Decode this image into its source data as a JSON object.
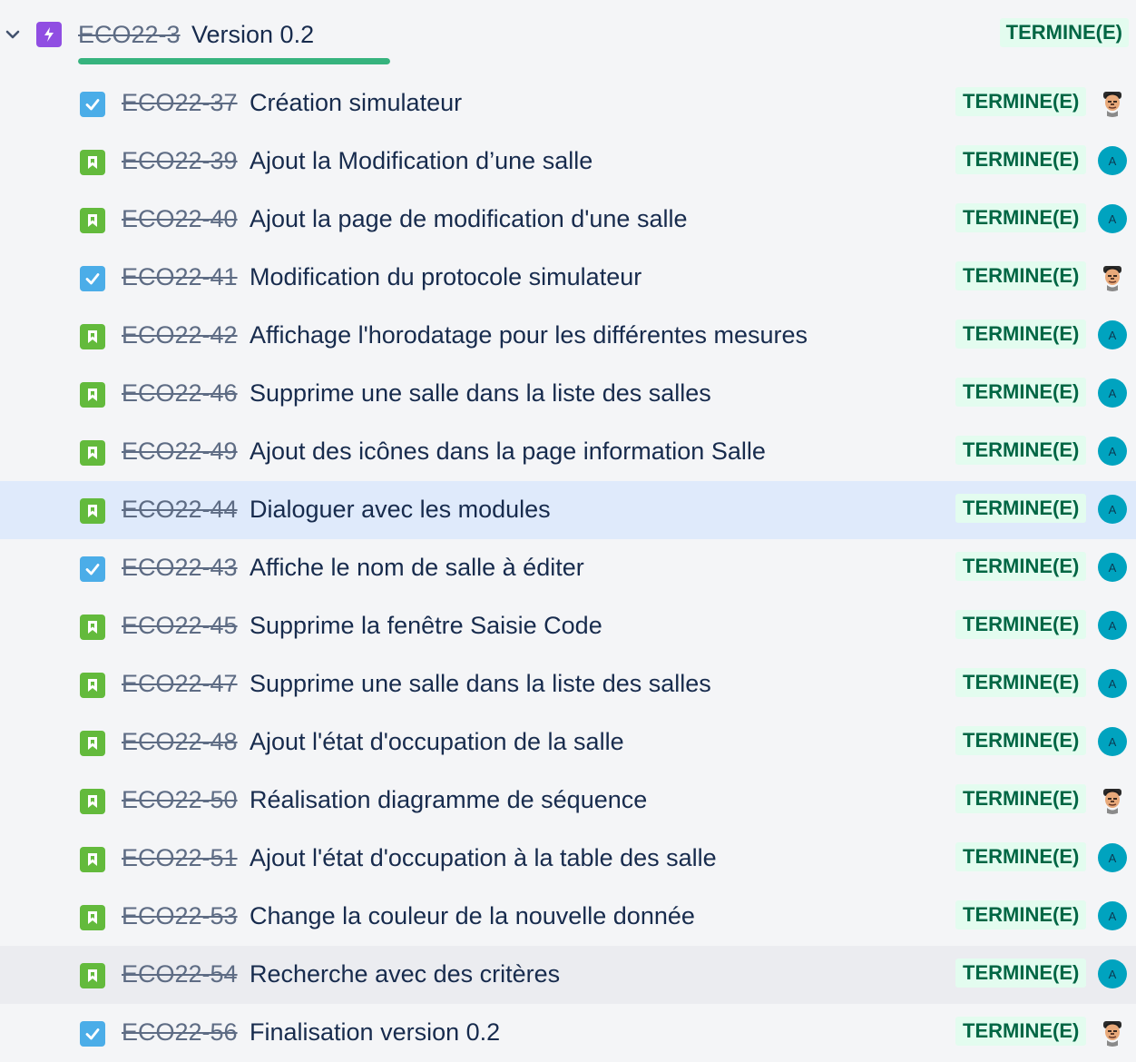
{
  "epic": {
    "key": "ECO22-3",
    "title": "Version 0.2",
    "status": "TERMINE(E)",
    "progress": 1.0,
    "icon": "epic-lightning-icon"
  },
  "colors": {
    "epic": "#904ee2",
    "task": "#4bade8",
    "story": "#63ba3c",
    "done_bg": "#e3fcef",
    "done_text": "#006644",
    "progress": "#36b37e",
    "avatar_initial": "#00a3bf"
  },
  "issues": [
    {
      "type": "task",
      "key": "ECO22-37",
      "summary": "Création simulateur",
      "status": "TERMINE(E)",
      "avatar": "photo"
    },
    {
      "type": "story",
      "key": "ECO22-39",
      "summary": "Ajout la Modification d’une salle",
      "status": "TERMINE(E)",
      "avatar": "A"
    },
    {
      "type": "story",
      "key": "ECO22-40",
      "summary": "Ajout la page de modification d'une salle",
      "status": "TERMINE(E)",
      "avatar": "A"
    },
    {
      "type": "task",
      "key": "ECO22-41",
      "summary": "Modification du protocole simulateur",
      "status": "TERMINE(E)",
      "avatar": "photo"
    },
    {
      "type": "story",
      "key": "ECO22-42",
      "summary": "Affichage l'horodatage pour les différentes mesures",
      "status": "TERMINE(E)",
      "avatar": "A"
    },
    {
      "type": "story",
      "key": "ECO22-46",
      "summary": "Supprime une salle dans la liste des salles",
      "status": "TERMINE(E)",
      "avatar": "A"
    },
    {
      "type": "story",
      "key": "ECO22-49",
      "summary": "Ajout des icônes dans la page information Salle",
      "status": "TERMINE(E)",
      "avatar": "A"
    },
    {
      "type": "story",
      "key": "ECO22-44",
      "summary": "Dialoguer avec les modules",
      "status": "TERMINE(E)",
      "avatar": "A",
      "state": "selected"
    },
    {
      "type": "task",
      "key": "ECO22-43",
      "summary": "Affiche le nom de salle à éditer",
      "status": "TERMINE(E)",
      "avatar": "A"
    },
    {
      "type": "story",
      "key": "ECO22-45",
      "summary": "Supprime la fenêtre Saisie Code",
      "status": "TERMINE(E)",
      "avatar": "A"
    },
    {
      "type": "story",
      "key": "ECO22-47",
      "summary": "Supprime une salle dans la liste des salles",
      "status": "TERMINE(E)",
      "avatar": "A"
    },
    {
      "type": "story",
      "key": "ECO22-48",
      "summary": "Ajout l'état d'occupation de la salle",
      "status": "TERMINE(E)",
      "avatar": "A"
    },
    {
      "type": "story",
      "key": "ECO22-50",
      "summary": "Réalisation diagramme de séquence",
      "status": "TERMINE(E)",
      "avatar": "photo"
    },
    {
      "type": "story",
      "key": "ECO22-51",
      "summary": "Ajout l'état d'occupation à la table des salle",
      "status": "TERMINE(E)",
      "avatar": "A"
    },
    {
      "type": "story",
      "key": "ECO22-53",
      "summary": "Change la couleur de la nouvelle donnée",
      "status": "TERMINE(E)",
      "avatar": "A"
    },
    {
      "type": "story",
      "key": "ECO22-54",
      "summary": "Recherche avec des critères",
      "status": "TERMINE(E)",
      "avatar": "A",
      "state": "hover"
    },
    {
      "type": "task",
      "key": "ECO22-56",
      "summary": "Finalisation version 0.2",
      "status": "TERMINE(E)",
      "avatar": "photo"
    }
  ]
}
